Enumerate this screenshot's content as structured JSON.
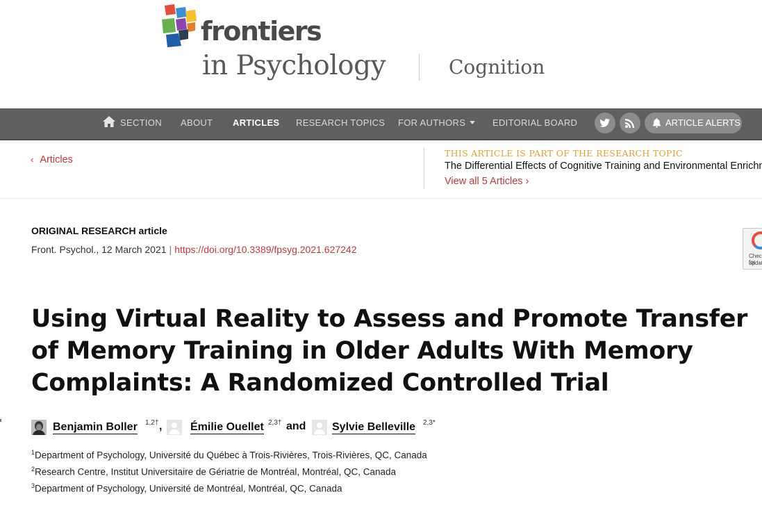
{
  "header": {
    "brand": "frontiers",
    "journal": "in Psychology",
    "section": "Cognition",
    "logo_colors": [
      "#e94d3a",
      "#3a8fd6",
      "#f6c02b",
      "#6ab04c",
      "#8e44ad",
      "#1f5fa8"
    ]
  },
  "nav": {
    "items": [
      {
        "label": "SECTION",
        "icon": "home-icon"
      },
      {
        "label": "ABOUT"
      },
      {
        "label": "ARTICLES",
        "active": true
      },
      {
        "label": "RESEARCH TOPICS"
      },
      {
        "label": "FOR AUTHORS",
        "dropdown": true
      },
      {
        "label": "EDITORIAL BOARD"
      }
    ],
    "social": [
      "twitter-icon",
      "rss-icon"
    ],
    "alerts_label": "ARTICLE ALERTS",
    "bg_color": "#5f5f5f",
    "button_color": "#8c8c8c"
  },
  "topic_band": {
    "back_label": "Articles",
    "kicker": "THIS ARTICLE IS PART OF THE RESEARCH TOPIC",
    "title": "The Differential Effects of Cognitive Training and Environmental Enrichment",
    "view_all": "View all 5 Articles ›",
    "accent_color": "#c4373a",
    "kicker_color": "#e2a02f"
  },
  "article": {
    "type": "ORIGINAL RESEARCH article",
    "journal_ref": "Front. Psychol., 12 March 2021",
    "separator": "|",
    "doi": "https://doi.org/10.3389/fpsyg.2021.627242",
    "crossmark": {
      "line1": "Check for",
      "line2": "updates"
    },
    "title": "Using Virtual Reality to Assess and Promote Transfer of Memory Training in Older Adults With Memory Complaints: A Randomized Controlled Trial",
    "authors": [
      {
        "name": "Benjamin Boller",
        "sup": "1,2†",
        "has_photo": true
      },
      {
        "name": "Émilie Ouellet",
        "sup": "2,3†",
        "has_photo": false
      },
      {
        "name": "Sylvie Belleville",
        "sup": "2,3*",
        "has_photo": false
      }
    ],
    "author_separators": [
      ",",
      "and"
    ],
    "affiliations": [
      {
        "num": "1",
        "text": "Department of Psychology, Université du Québec à Trois-Rivières, Trois-Rivières, QC, Canada"
      },
      {
        "num": "2",
        "text": "Research Centre, Institut Universitaire de Gériatrie de Montréal, Montréal, QC, Canada"
      },
      {
        "num": "3",
        "text": "Department of Psychology, Université de Montréal, Montréal, QC, Canada"
      }
    ]
  }
}
